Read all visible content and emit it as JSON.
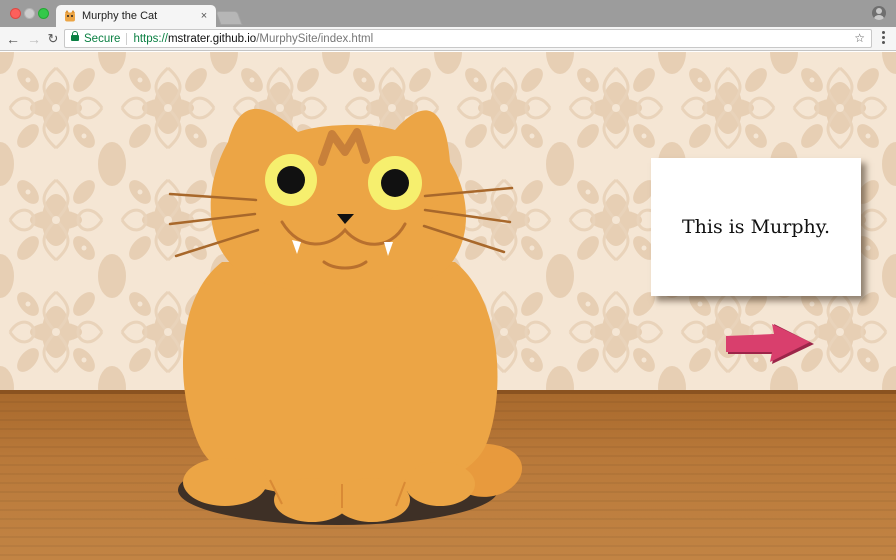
{
  "window": {
    "tab_title": "Murphy the Cat",
    "tab_close": "×"
  },
  "toolbar": {
    "back": "←",
    "forward": "→",
    "reload": "↻",
    "secure_label": "Secure",
    "url_scheme": "https://",
    "url_host": "mstrater.github.io",
    "url_path": "/MurphySite/index.html",
    "star": "☆"
  },
  "page": {
    "caption": "This is Murphy."
  },
  "colors": {
    "cat_body": "#eca545",
    "cat_dark": "#c8803a",
    "eye_ring": "#f6ef6e",
    "arrow": "#d93f6d",
    "wall": "#f5e6d4",
    "floor": "#b9793a"
  }
}
